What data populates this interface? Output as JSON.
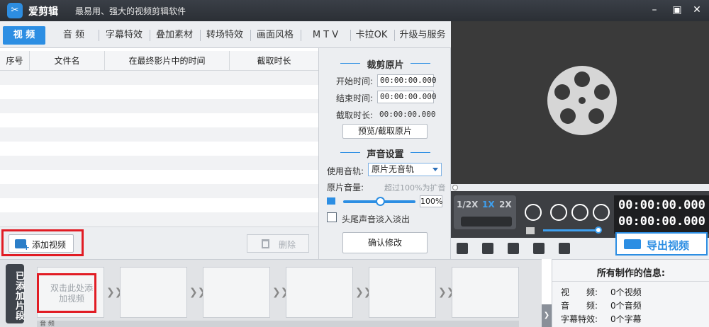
{
  "app": {
    "name": "爱剪辑",
    "slogan": "最易用、强大的视频剪辑软件",
    "accent_color": "#2c8ee3",
    "highlight_color": "#e11c24"
  },
  "window_controls": [
    "minimize-icon",
    "maximize-icon",
    "close-icon"
  ],
  "tabs": [
    {
      "label": "视 频",
      "active": true
    },
    {
      "label": "音 频"
    },
    {
      "label": "字幕特效"
    },
    {
      "label": "叠加素材"
    },
    {
      "label": "转场特效"
    },
    {
      "label": "画面风格"
    },
    {
      "label": "M T V"
    },
    {
      "label": "卡拉OK"
    },
    {
      "label": "升级与服务"
    }
  ],
  "file_table": {
    "columns": [
      "序号",
      "文件名",
      "在最终影片中的时间",
      "截取时长"
    ],
    "rows": []
  },
  "left_actions": {
    "add_video": "添加视频",
    "delete": "删除"
  },
  "crop": {
    "title": "裁剪原片",
    "start_label": "开始时间:",
    "start_value": "00:00:00.000",
    "end_label": "结束时间:",
    "end_value": "00:00:00.000",
    "duration_label": "截取时长:",
    "duration_value": "00:00:00.000",
    "preview_button": "预览/截取原片"
  },
  "audio": {
    "title": "声音设置",
    "track_label": "使用音轨:",
    "track_value": "原片无音轨",
    "volume_label": "原片音量:",
    "volume_hint": "超过100%为扩音",
    "volume_value": "100%",
    "fade_label": "头尾声音淡入淡出",
    "fade_checked": false
  },
  "confirm_button": "确认修改",
  "player": {
    "speeds": [
      "1/2X",
      "1X",
      "2X"
    ],
    "selected_speed": "1X",
    "time_current": "00:00:00.000",
    "time_total": "00:00:00.000",
    "volume_level": 0.9
  },
  "toolbar_icons": [
    "new-project-icon",
    "open-folder-icon",
    "save-icon",
    "help-icon",
    "share-icon"
  ],
  "export_button": "导出视频",
  "clips": {
    "label": "已添加片段",
    "placeholder": "双击此处添加视频",
    "audio_track_label": "音 频"
  },
  "info": {
    "title": "所有制作的信息:",
    "rows": [
      {
        "key": "视　　频:",
        "value": "0个视频"
      },
      {
        "key": "音　　频:",
        "value": "0个音频"
      },
      {
        "key": "字幕特效:",
        "value": "0个字幕"
      }
    ]
  }
}
